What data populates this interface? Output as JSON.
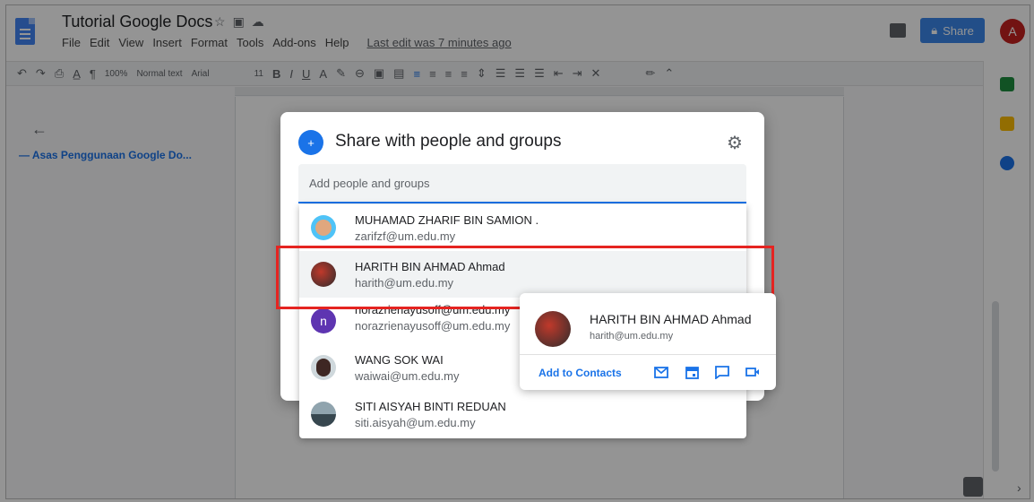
{
  "app": {
    "title": "Tutorial Google Docs",
    "menu": [
      "File",
      "Edit",
      "View",
      "Insert",
      "Format",
      "Tools",
      "Add-ons",
      "Help"
    ],
    "last_edit": "Last edit was 7 minutes ago",
    "share_label": "Share",
    "user_initial": "A"
  },
  "toolbar": {
    "zoom": "100%",
    "style": "Normal text",
    "font": "Arial",
    "font_size": "11"
  },
  "outline": {
    "heading": "Asas Penggunaan Google Do..."
  },
  "dialog": {
    "title": "Share with people and groups",
    "input_placeholder": "Add people and groups"
  },
  "suggestions": [
    {
      "name": "MUHAMAD ZHARIF BIN SAMION .",
      "email": "zarifzf@um.edu.my"
    },
    {
      "name": "HARITH BIN AHMAD Ahmad",
      "email": "harith@um.edu.my"
    },
    {
      "name": "norazrienayusoff@um.edu.my",
      "email": "norazrienayusoff@um.edu.my",
      "initial": "n"
    },
    {
      "name": "WANG SOK WAI",
      "email": "waiwai@um.edu.my"
    },
    {
      "name": "SITI AISYAH BINTI REDUAN",
      "email": "siti.aisyah@um.edu.my"
    }
  ],
  "contact_card": {
    "name": "HARITH BIN AHMAD Ahmad",
    "email": "harith@um.edu.my",
    "add_label": "Add to Contacts"
  },
  "colors": {
    "accent": "#1a73e8",
    "highlight": "#e52421"
  }
}
